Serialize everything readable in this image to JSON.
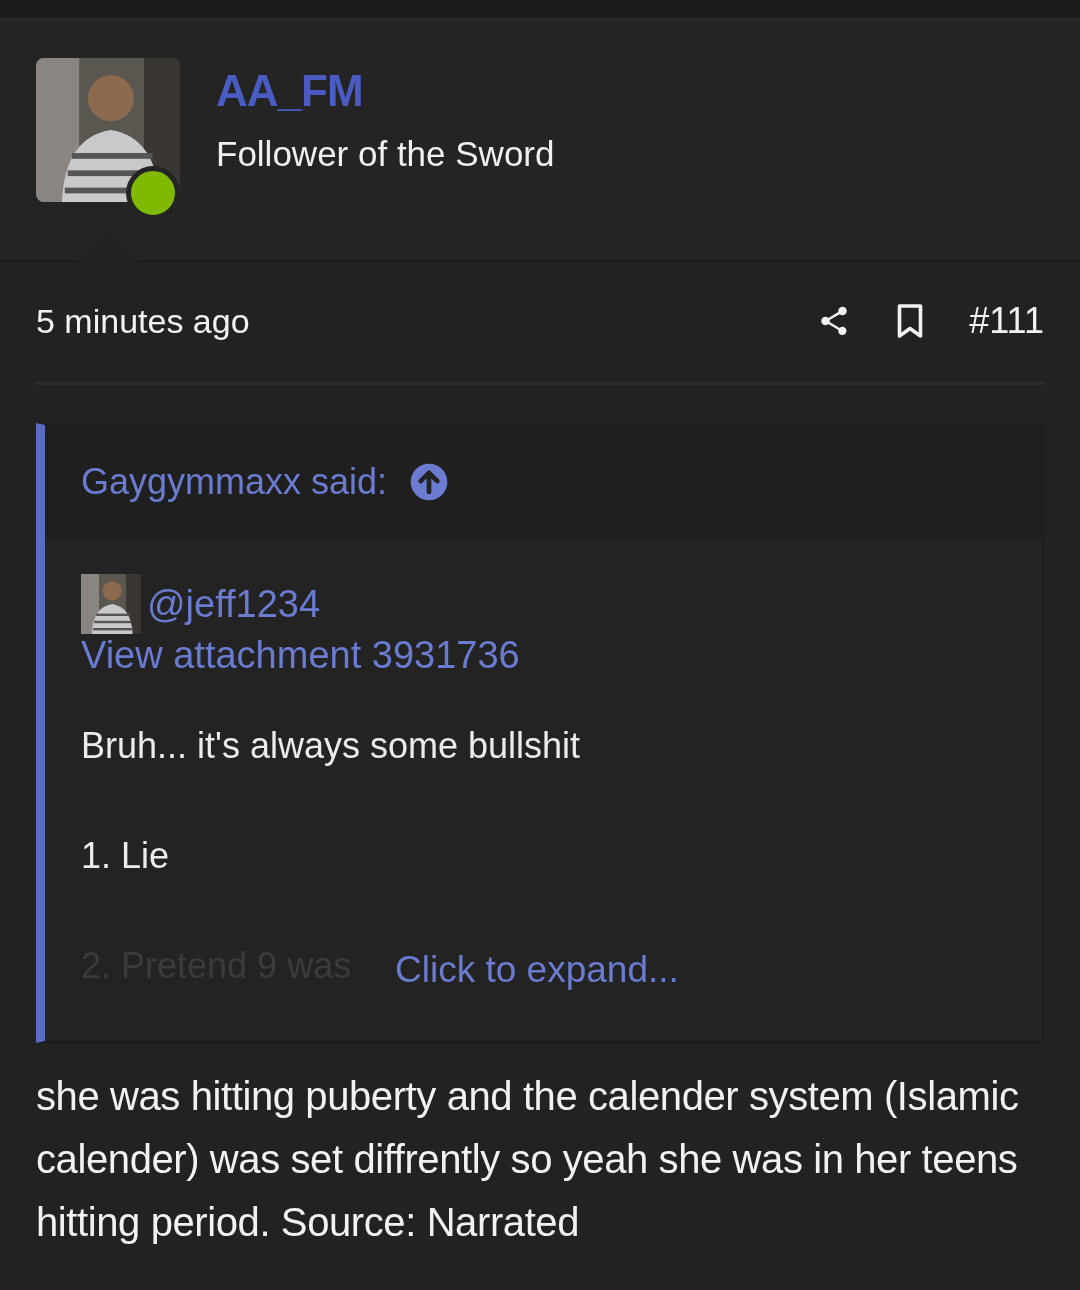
{
  "post": {
    "author": {
      "online": true,
      "name": "AA_FM",
      "title": "Follower of the Sword"
    },
    "time": "5 minutes ago",
    "number": "#111",
    "quote": {
      "author": "Gaygymmaxx said:",
      "lines": [
        {
          "kind": "mention",
          "text": "@jeff1234"
        },
        {
          "kind": "link",
          "text": "View attachment 3931736"
        },
        {
          "kind": "text",
          "text": "Bruh... it's always some bullshit"
        },
        {
          "kind": "text",
          "text": "1. Lie"
        },
        {
          "kind": "faded",
          "text": "2. Pretend 9 was"
        }
      ],
      "expand": "Click to expand..."
    },
    "body": "she was hitting puberty and the calender system (Islamic calender) was set diffrently so yeah she was in her teens hitting period. Source: Narrated"
  }
}
